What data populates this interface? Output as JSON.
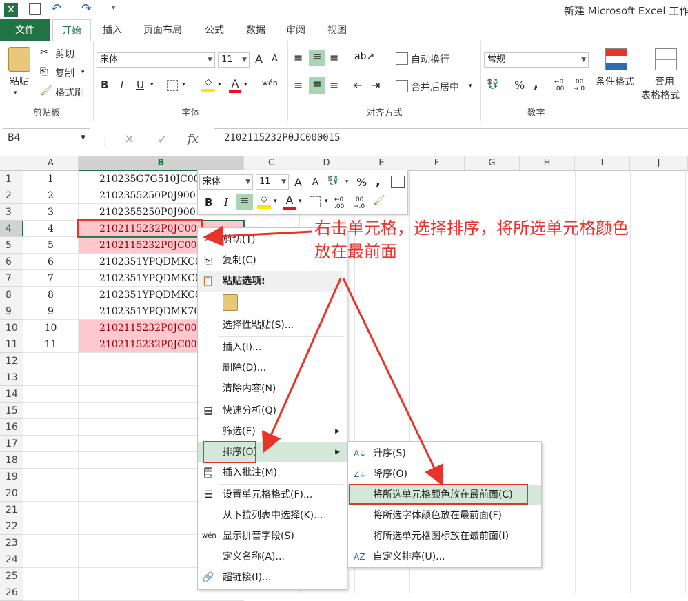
{
  "window": {
    "title": "新建 Microsoft Excel 工作"
  },
  "tabs": [
    "文件",
    "开始",
    "插入",
    "页面布局",
    "公式",
    "数据",
    "审阅",
    "视图"
  ],
  "ribbon": {
    "clipboard": {
      "paste": "粘贴",
      "cut": "剪切",
      "copy": "复制",
      "format_painter": "格式刷",
      "label": "剪贴板"
    },
    "font": {
      "name": "宋体",
      "size": "11",
      "label": "字体",
      "bold": "B",
      "italic": "I",
      "underline": "U",
      "grow": "A",
      "shrink": "A",
      "font_color": "A"
    },
    "alignment": {
      "wrap": "自动换行",
      "merge": "合并后居中",
      "label": "对齐方式"
    },
    "number": {
      "format": "常规",
      "percent": "%",
      "comma": ",",
      "label": "数字"
    },
    "styles": {
      "cond": "条件格式",
      "table1": "套用",
      "table2": "表格格式"
    }
  },
  "formula": {
    "namebox": "B4",
    "fx": "fx",
    "value": "2102115232P0JC000015"
  },
  "columns": [
    "A",
    "B",
    "C",
    "D",
    "E",
    "F",
    "G",
    "H",
    "I",
    "J"
  ],
  "rows": [
    {
      "n": "1",
      "a": "1",
      "b": "210235G7G510JC00",
      "pink": false
    },
    {
      "n": "2",
      "a": "2",
      "b": "2102355250P0J900",
      "pink": false
    },
    {
      "n": "3",
      "a": "3",
      "b": "2102355250P0J900",
      "pink": false
    },
    {
      "n": "4",
      "a": "4",
      "b": "2102115232P0JC00",
      "pink": true
    },
    {
      "n": "5",
      "a": "5",
      "b": "2102115232P0JC00",
      "pink": true
    },
    {
      "n": "6",
      "a": "6",
      "b": "2102351YPQDMKC00",
      "pink": false
    },
    {
      "n": "7",
      "a": "7",
      "b": "2102351YPQDMKC00",
      "pink": false
    },
    {
      "n": "8",
      "a": "8",
      "b": "2102351YPQDMKC00",
      "pink": false
    },
    {
      "n": "9",
      "a": "9",
      "b": "2102351YPQDMK700",
      "pink": false
    },
    {
      "n": "10",
      "a": "10",
      "b": "2102115232P0JC00",
      "pink": true
    },
    {
      "n": "11",
      "a": "11",
      "b": "2102115232P0JC00",
      "pink": true
    },
    {
      "n": "12",
      "a": "",
      "b": "",
      "pink": false
    },
    {
      "n": "13",
      "a": "",
      "b": "",
      "pink": false
    },
    {
      "n": "14",
      "a": "",
      "b": "",
      "pink": false
    },
    {
      "n": "15",
      "a": "",
      "b": "",
      "pink": false
    },
    {
      "n": "16",
      "a": "",
      "b": "",
      "pink": false
    },
    {
      "n": "17",
      "a": "",
      "b": "",
      "pink": false
    },
    {
      "n": "18",
      "a": "",
      "b": "",
      "pink": false
    },
    {
      "n": "19",
      "a": "",
      "b": "",
      "pink": false
    },
    {
      "n": "20",
      "a": "",
      "b": "",
      "pink": false
    },
    {
      "n": "21",
      "a": "",
      "b": "",
      "pink": false
    },
    {
      "n": "22",
      "a": "",
      "b": "",
      "pink": false
    },
    {
      "n": "23",
      "a": "",
      "b": "",
      "pink": false
    },
    {
      "n": "24",
      "a": "",
      "b": "",
      "pink": false
    },
    {
      "n": "25",
      "a": "",
      "b": "",
      "pink": false
    },
    {
      "n": "26",
      "a": "",
      "b": "",
      "pink": false
    }
  ],
  "minibar": {
    "font": "宋体",
    "size": "11",
    "percent": "%",
    "comma": ",",
    "bold": "B",
    "italic": "I"
  },
  "context_menu": {
    "cut": "剪切(T)",
    "copy": "复制(C)",
    "paste_options": "粘贴选项:",
    "paste_special": "选择性粘贴(S)...",
    "insert": "插入(I)...",
    "delete": "删除(D)...",
    "clear": "清除内容(N)",
    "quick_analysis": "快速分析(Q)",
    "filter": "筛选(E)",
    "sort": "排序(O)",
    "insert_comment": "插入批注(M)",
    "format_cells": "设置单元格格式(F)...",
    "pick_list": "从下拉列表中选择(K)...",
    "phonetic": "显示拼音字段(S)",
    "define_name": "定义名称(A)...",
    "hyperlink": "超链接(I)..."
  },
  "sort_submenu": {
    "asc": "升序(S)",
    "desc": "降序(O)",
    "cell_color": "将所选单元格颜色放在最前面(C)",
    "font_color": "将所选字体颜色放在最前面(F)",
    "icon": "将所选单元格图标放在最前面(I)",
    "custom": "自定义排序(U)..."
  },
  "annotation": {
    "line1": "右击单元格，选择排序，将所选单元格颜色",
    "line2": "放在最前面"
  },
  "colors": {
    "accent": "#217346",
    "pink": "#ffc7ce",
    "annotation": "#e8332a"
  }
}
